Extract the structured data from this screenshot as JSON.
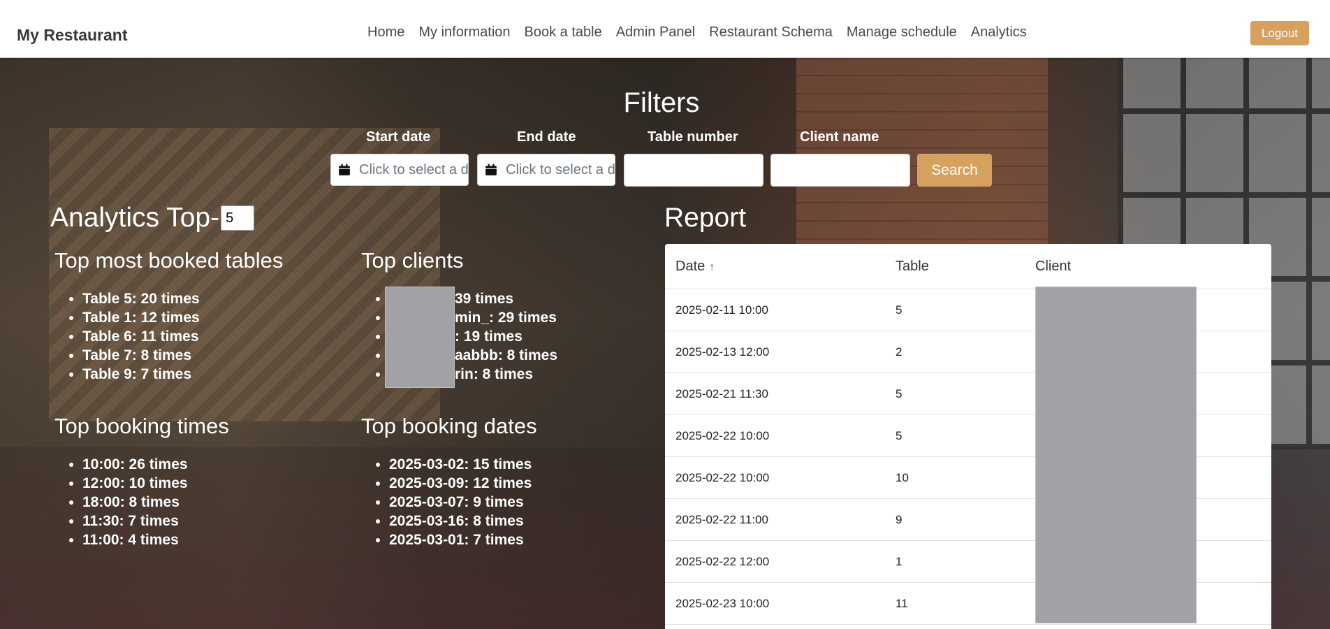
{
  "navbar": {
    "brand": "My Restaurant",
    "links": [
      "Home",
      "My information",
      "Book a table",
      "Admin Panel",
      "Restaurant Schema",
      "Manage schedule",
      "Analytics"
    ],
    "logout_label": "Logout"
  },
  "filters": {
    "title": "Filters",
    "start_date_label": "Start date",
    "end_date_label": "End date",
    "table_number_label": "Table number",
    "client_name_label": "Client name",
    "date_placeholder": "Click to select a date",
    "search_label": "Search"
  },
  "analytics": {
    "title": "Analytics Top-",
    "top_n_value": "5",
    "top_tables": {
      "title": "Top most booked tables",
      "items": [
        "Table 5: 20 times",
        "Table 1: 12 times",
        "Table 6: 11 times",
        "Table 7: 8 times",
        "Table 9: 7 times"
      ]
    },
    "top_clients": {
      "title": "Top clients",
      "items": [
        "39 times",
        "min_: 29 times",
        ": 19 times",
        "aabbb: 8 times",
        "rin: 8 times"
      ]
    },
    "top_times": {
      "title": "Top booking times",
      "items": [
        "10:00: 26 times",
        "12:00: 10 times",
        "18:00: 8 times",
        "11:30: 7 times",
        "11:00: 4 times"
      ]
    },
    "top_dates": {
      "title": "Top booking dates",
      "items": [
        "2025-03-02: 15 times",
        "2025-03-09: 12 times",
        "2025-03-07: 9 times",
        "2025-03-16: 8 times",
        "2025-03-01: 7 times"
      ]
    }
  },
  "report": {
    "title": "Report",
    "columns": [
      "Date",
      "Table",
      "Client"
    ],
    "rows": [
      {
        "date": "2025-02-11 10:00",
        "table": "5"
      },
      {
        "date": "2025-02-13 12:00",
        "table": "2"
      },
      {
        "date": "2025-02-21 11:30",
        "table": "5"
      },
      {
        "date": "2025-02-22 10:00",
        "table": "5"
      },
      {
        "date": "2025-02-22 10:00",
        "table": "10"
      },
      {
        "date": "2025-02-22 11:00",
        "table": "9"
      },
      {
        "date": "2025-02-22 12:00",
        "table": "1"
      },
      {
        "date": "2025-02-23 10:00",
        "table": "11"
      }
    ]
  },
  "icons": {
    "calendar": "calendar-icon",
    "sort": "sort-ascending-icon"
  },
  "colors": {
    "accent": "#d6a15f",
    "redaction": "#a1a2a5"
  }
}
